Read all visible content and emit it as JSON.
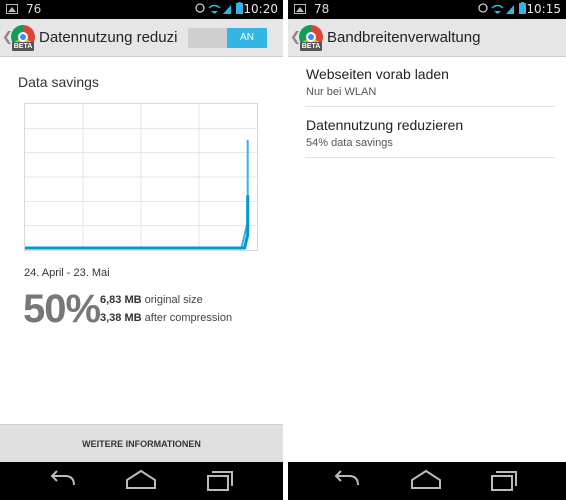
{
  "left": {
    "status_bar": {
      "notification_count": "76",
      "time": "10:20"
    },
    "action_bar": {
      "beta_badge": "BETA",
      "title": "Datennutzung reduzi",
      "toggle_label": "AN"
    },
    "section_title": "Data savings",
    "date_range": "24. April - 23. Mai",
    "savings": {
      "percent": "50%",
      "original_size": "6,83 MB",
      "original_label": "original size",
      "compressed_size": "3,38 MB",
      "compressed_label": "after compression"
    },
    "more_button": "WEITERE INFORMATIONEN"
  },
  "right": {
    "status_bar": {
      "notification_count": "78",
      "time": "10:15"
    },
    "action_bar": {
      "beta_badge": "BETA",
      "title": "Bandbreitenverwaltung"
    },
    "preferences": [
      {
        "title": "Webseiten vorab laden",
        "summary": "Nur bei WLAN"
      },
      {
        "title": "Datennutzung reduzieren",
        "summary": "54% data savings"
      }
    ]
  },
  "colors": {
    "accent": "#33b5e5",
    "compressed_line": "#0099cc",
    "status_bar": "#000000",
    "action_bar": "#e6e6e6"
  },
  "chart_data": {
    "type": "line",
    "title": "",
    "xlabel": "",
    "ylabel": "",
    "xlim": [
      0,
      30
    ],
    "ylim": [
      0,
      100
    ],
    "grid": true,
    "grid_cols": 4,
    "grid_rows": 6,
    "series": [
      {
        "x": [
          0,
          27,
          28,
          28.8,
          28.8
        ],
        "values": [
          0,
          0,
          0,
          20,
          82
        ],
        "color": "#33b5e5"
      },
      {
        "x": [
          0,
          27.6,
          28.4,
          28.8,
          28.8
        ],
        "values": [
          0,
          0,
          0,
          10,
          40
        ],
        "color": "#0099cc"
      }
    ]
  }
}
